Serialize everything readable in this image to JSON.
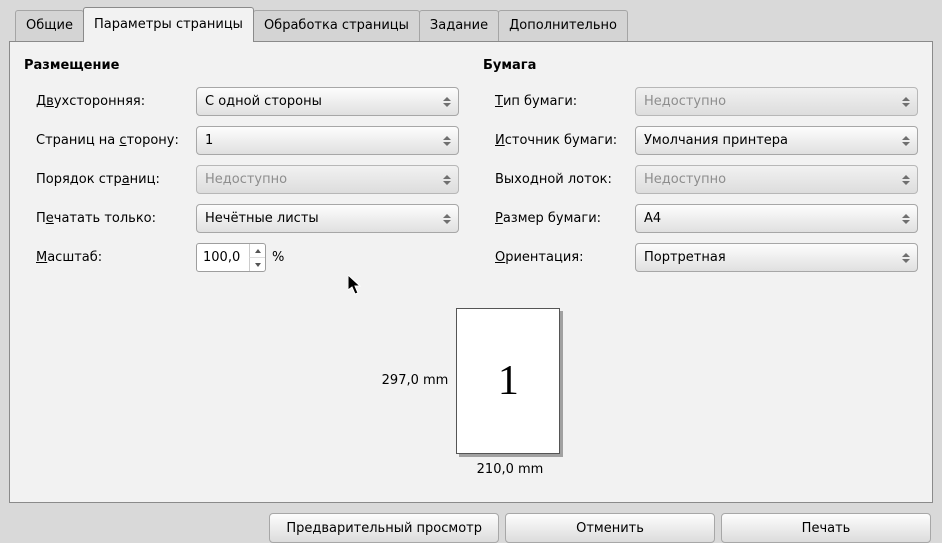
{
  "tabs": {
    "general": "Общие",
    "page_setup": "Параметры страницы",
    "page_handling": "Обработка страницы",
    "job": "Задание",
    "advanced": "Дополнительно"
  },
  "layout": {
    "title": "Размещение",
    "two_sided": {
      "label_pre": "Д",
      "label_u": "в",
      "label_post": "ухсторонняя:",
      "value": "С одной стороны"
    },
    "pages_per_side": {
      "label_pre": "Страниц на ",
      "label_u": "с",
      "label_post": "торону:",
      "value": "1"
    },
    "page_order": {
      "label_pre": "Порядок стр",
      "label_u": "а",
      "label_post": "ниц:",
      "value": "Недоступно"
    },
    "only_print": {
      "label_pre": "П",
      "label_u": "е",
      "label_post": "чатать только:",
      "value": "Нечётные листы"
    },
    "scale": {
      "label_u": "М",
      "label_post": "асштаб:",
      "value": "100,0",
      "suffix": "%"
    }
  },
  "paper": {
    "title": "Бумага",
    "type": {
      "label_u": "Т",
      "label_post": "ип бумаги:",
      "value": "Недоступно"
    },
    "source": {
      "label_u": "И",
      "label_post": "сточник бумаги:",
      "value": "Умолчания принтера"
    },
    "output_tray": {
      "label": "Выходной лоток:",
      "value": "Недоступно"
    },
    "size": {
      "label_u": "Р",
      "label_post": "азмер бумаги:",
      "value": "A4"
    },
    "orientation": {
      "label_u": "О",
      "label_post": "риентация:",
      "value": "Портретная"
    }
  },
  "preview": {
    "height_label": "297,0 mm",
    "width_label": "210,0 mm",
    "page_number": "1"
  },
  "buttons": {
    "preview": "Предварительный просмотр",
    "cancel": "Отменить",
    "print": "Печать"
  }
}
